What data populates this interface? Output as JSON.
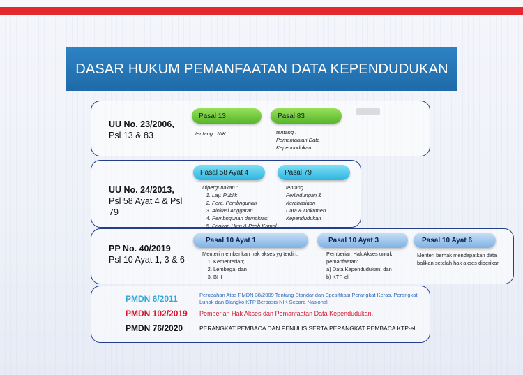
{
  "colors": {
    "red_line": "#e3282e",
    "title_bg": "#1f6aa9",
    "border": "#243f8a",
    "pmdn1": "#2fa8d8",
    "pmdn2": "#d4152b",
    "pmdn3": "#111111",
    "desc1": "#2f6ab8"
  },
  "title": "DASAR HUKUM PEMANFAATAN DATA KEPENDUDUKAN",
  "row1": {
    "law_line1": "UU No. 23/2006,",
    "law_line2": "Psl 13 & 83",
    "pill_a": "Pasal 13",
    "note_a": "tentang : NIK",
    "pill_b": "Pasal 83",
    "note_b": [
      "tentang :",
      "Pemanfaatan Data",
      "Kependudukan"
    ]
  },
  "row2": {
    "law_line1": "UU No. 24/2013,",
    "law_line2": "Psl 58 Ayat 4 & Psl",
    "law_line3": "79",
    "pill_a": "Pasal 58 Ayat 4",
    "note_a_head": "Dipergunakan :",
    "note_a_items": [
      "Lay. Publik",
      "Perc. Pembngunan",
      "Alokasi Anggaran",
      "Pembngunan demokrasi",
      "Pngkan Hkm & Pcgh Krimnl"
    ],
    "pill_b": "Pasal 79",
    "note_b": [
      "tentang",
      "Perlindungan &",
      "Kerahasiaan",
      "Data & Dokumen",
      "Kependudukan"
    ]
  },
  "row3": {
    "law_line1": "PP No. 40/2019",
    "law_line2": "Psl 10 Ayat 1, 3 & 6",
    "pill_a": "Pasal 10 Ayat 1",
    "text_a_head": "Menteri memberikan hak akses yg terdiri:",
    "text_a_items": [
      "Kementerian;",
      "Lembaga; dan",
      "BHI"
    ],
    "pill_b": "Pasal 10 Ayat 3",
    "text_b_head": [
      "Pemberian Hak Akses untuk",
      "pemanfaatan:"
    ],
    "text_b_items": [
      "a)  Data Kependudukan; dan",
      "b)  KTP-el"
    ],
    "pill_c": "Pasal 10 Ayat 6",
    "text_c": [
      "Menteri berhak mendapatkan data",
      "balikan setelah hak akses diberikan"
    ]
  },
  "row4": {
    "p1_name": "PMDN 6/2011",
    "p1_desc": [
      "Perubahan Atas PMDN 38/2009 Tentang Standar dan Spesifikasi Perangkat Keras, Perangkat",
      "Lunak dan Blangko KTP Berbasis NIK Secara Nasional"
    ],
    "p2_name": "PMDN 102/2019",
    "p2_desc": "Pemberian Hak Akses dan Pemanfaatan Data Kependudukan.",
    "p3_name": "PMDN 76/2020",
    "p3_desc": "PERANGKAT PEMBACA DAN PENULIS SERTA PERANGKAT PEMBACA KTP-el"
  }
}
